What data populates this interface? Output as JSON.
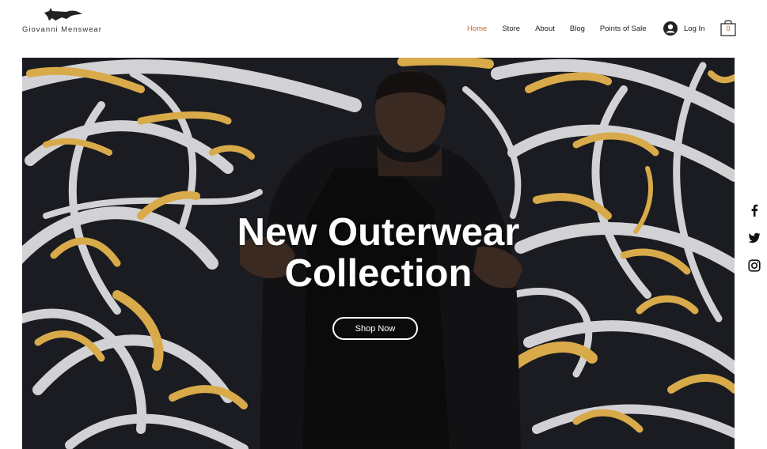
{
  "brand": {
    "name": "Giovanni Menswear",
    "logo_icon": "fox-icon"
  },
  "nav": {
    "items": [
      {
        "label": "Home",
        "active": true
      },
      {
        "label": "Store",
        "active": false
      },
      {
        "label": "About",
        "active": false
      },
      {
        "label": "Blog",
        "active": false
      },
      {
        "label": "Points of Sale",
        "active": false
      }
    ]
  },
  "account": {
    "login_label": "Log In",
    "icon": "user-avatar-icon"
  },
  "cart": {
    "count": "0",
    "icon": "shopping-bag-icon"
  },
  "hero": {
    "headline_line1": "New Outerwear",
    "headline_line2": "Collection",
    "cta_label": "Shop Now"
  },
  "social": [
    "facebook-icon",
    "twitter-icon",
    "instagram-icon"
  ],
  "colors": {
    "accent": "#c16b2c",
    "gold": "#d9aa4a",
    "dark": "#1c1d22",
    "white": "#ffffff"
  }
}
